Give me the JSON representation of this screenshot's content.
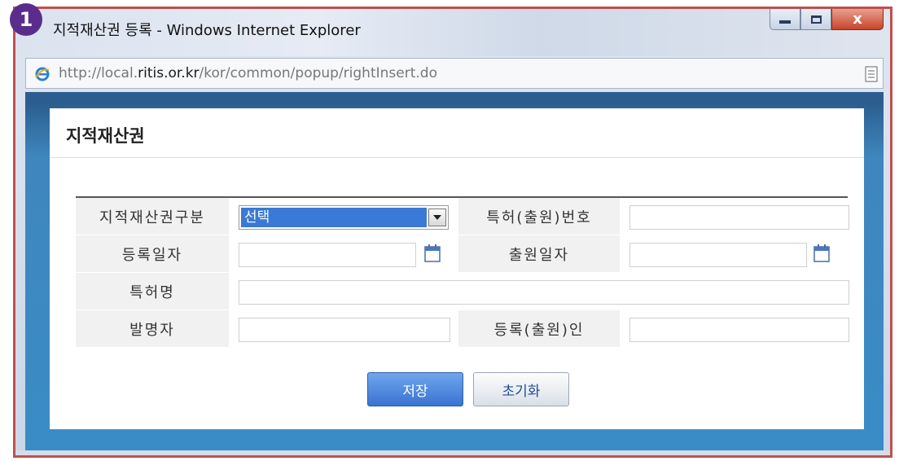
{
  "step_badge": "1",
  "window": {
    "title": "지적재산권 등록 - Windows Internet Explorer",
    "buttons": [
      "minimize",
      "maximize",
      "close"
    ],
    "close_glyph": "x"
  },
  "address": {
    "url_prefix": "http://local.",
    "url_domain": "ritis.or.kr",
    "url_path": "/kor/common/popup/rightInsert.do"
  },
  "dialog": {
    "title": "지적재산권"
  },
  "form": {
    "category_label": "지적재산권구분",
    "category_value": "선택",
    "patent_no_label": "특허(출원)번호",
    "patent_no_value": "",
    "reg_date_label": "등록일자",
    "reg_date_value": "",
    "app_date_label": "출원일자",
    "app_date_value": "",
    "patent_name_label": "특허명",
    "patent_name_value": "",
    "inventor_label": "발명자",
    "inventor_value": "",
    "registrant_label": "등록(출원)인",
    "registrant_value": ""
  },
  "actions": {
    "save_label": "저장",
    "reset_label": "초기화"
  },
  "icons": {
    "browser": "ie-icon",
    "page": "page-icon",
    "calendar": "calendar-icon",
    "dropdown": "chevron-down-icon"
  },
  "colors": {
    "window_border": "#c0504d",
    "badge": "#5a2d8c",
    "selection": "#3a79d6",
    "save_button": "#3a73d0",
    "backdrop": "#3a8cc7"
  }
}
